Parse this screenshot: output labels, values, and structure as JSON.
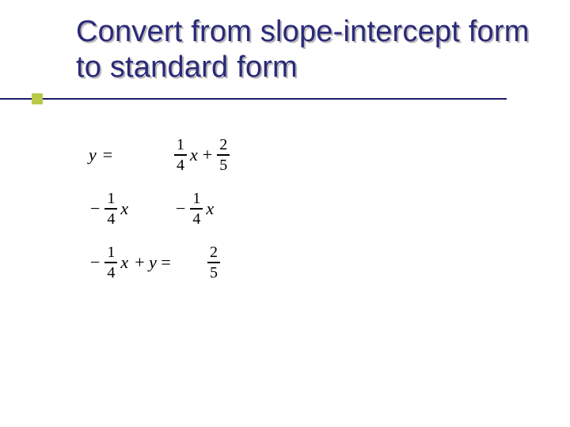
{
  "title": "Convert from slope-intercept form to standard form",
  "rows": [
    {
      "left": {
        "prefix": "",
        "frac": null,
        "var": "y",
        "suffix": "=",
        "plain": true
      },
      "right": {
        "sign": "",
        "frac": {
          "n": "1",
          "d": "4"
        },
        "var": "x",
        "op": "+",
        "frac2": {
          "n": "2",
          "d": "5"
        },
        "var2": ""
      }
    },
    {
      "left": {
        "prefix": "−",
        "frac": {
          "n": "1",
          "d": "4"
        },
        "var": "x",
        "suffix": ""
      },
      "right": {
        "sign": "−",
        "frac": {
          "n": "1",
          "d": "4"
        },
        "var": "x",
        "op": "",
        "frac2": null,
        "var2": ""
      }
    },
    {
      "left": {
        "prefix": "−",
        "frac": {
          "n": "1",
          "d": "4"
        },
        "var": "x",
        "suffix": "+ y ="
      },
      "right": {
        "sign": "",
        "frac": {
          "n": "2",
          "d": "5"
        },
        "var": "",
        "op": "",
        "frac2": null,
        "var2": ""
      }
    }
  ]
}
